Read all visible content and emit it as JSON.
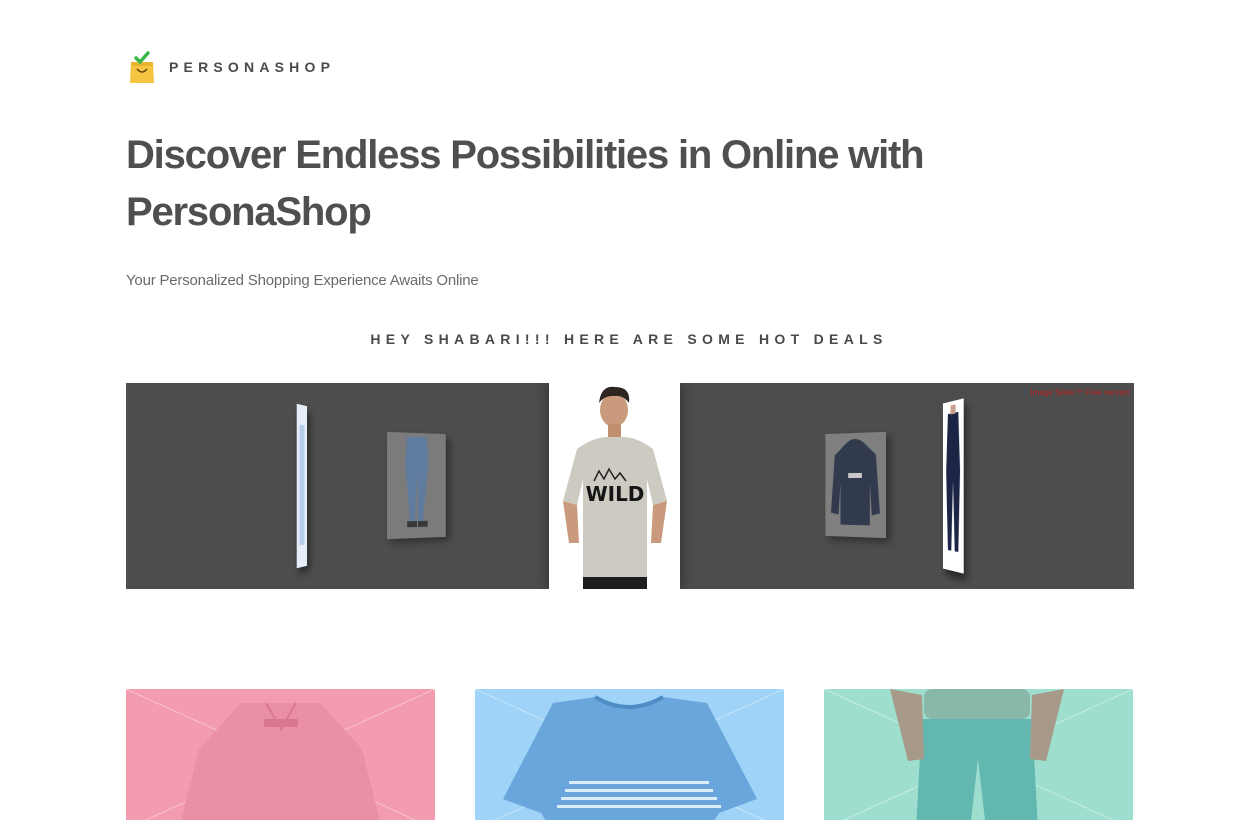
{
  "brand": {
    "name": "PERSONASHOP",
    "logo_icon": "shopping-bag-check-icon",
    "colors": {
      "bag": "#f5c542",
      "check": "#3bb54a"
    }
  },
  "hero": {
    "title": "Discover Endless Possibilities in Online with PersonaShop",
    "subtitle": "Your Personalized Shopping Experience Awaits Online"
  },
  "deals": {
    "heading": "HEY SHABARI!!! HERE ARE SOME HOT DEALS",
    "watermark": "Image Slider™ Free version",
    "slides": [
      {
        "name": "blue-pattern-shirt",
        "position": "far-left"
      },
      {
        "name": "blue-jeans",
        "position": "left"
      },
      {
        "name": "wild-graphic-tshirt",
        "position": "center",
        "graphic_text": "WILD"
      },
      {
        "name": "navy-hoodie",
        "position": "right"
      },
      {
        "name": "navy-outfit",
        "position": "far-right"
      }
    ]
  },
  "products": [
    {
      "name": "pink-shirt",
      "background": "#f39cb0"
    },
    {
      "name": "blue-striped-tshirt",
      "background": "#9fd3f7"
    },
    {
      "name": "teal-jeans",
      "background": "#9edece"
    }
  ]
}
